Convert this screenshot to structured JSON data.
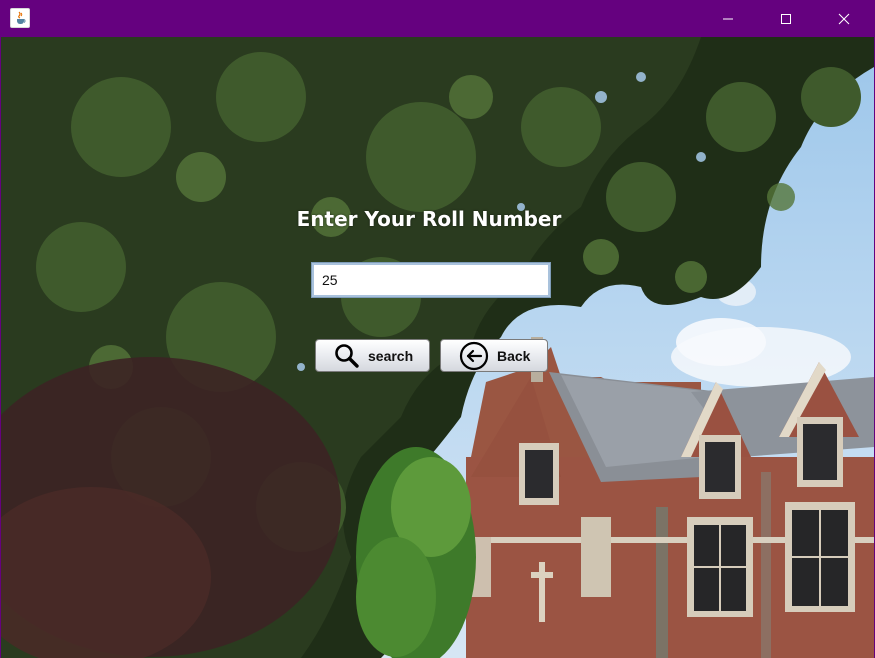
{
  "window": {
    "controls": {
      "minimize_icon": "minimize-icon",
      "maximize_icon": "maximize-icon",
      "close_icon": "close-icon"
    },
    "titlebar_color": "#65017f"
  },
  "form": {
    "heading": "Enter Your Roll Number",
    "roll_input": {
      "value": "25"
    },
    "search_button": {
      "label": "search",
      "icon": "magnifier-icon"
    },
    "back_button": {
      "label": "Back",
      "icon": "back-arrow-icon"
    }
  }
}
